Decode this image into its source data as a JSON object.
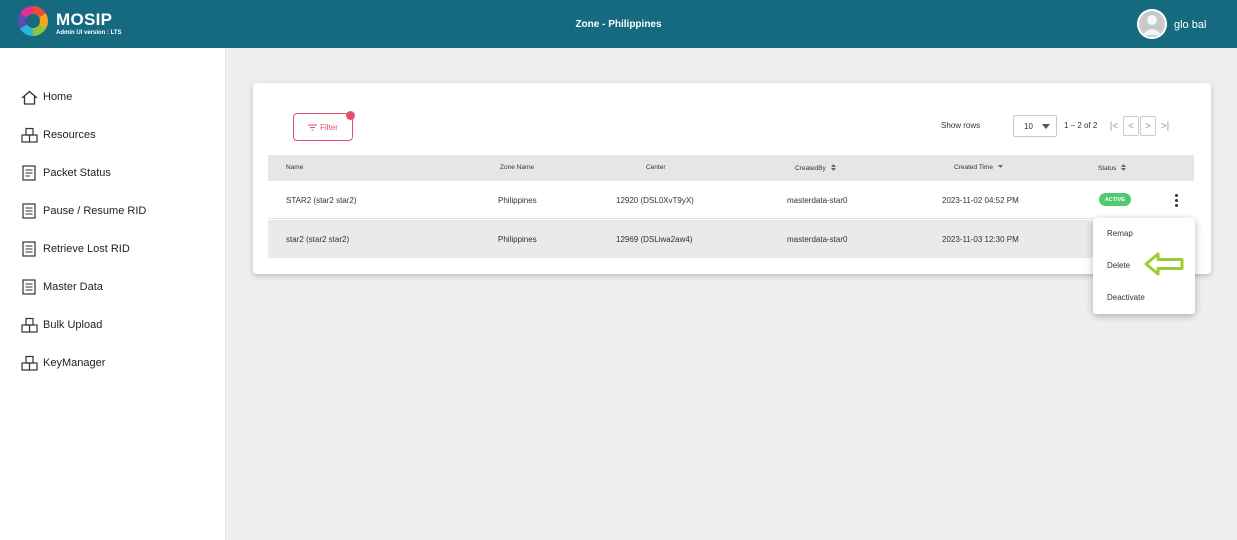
{
  "header": {
    "brand": "MOSIP",
    "version": "Admin UI version : LTS",
    "zone": "Zone - Philippines",
    "user_name": "glo bal"
  },
  "sidebar": {
    "items": [
      {
        "label": "Home",
        "icon": "home-icon"
      },
      {
        "label": "Resources",
        "icon": "resources-icon"
      },
      {
        "label": "Packet Status",
        "icon": "packet-status-icon"
      },
      {
        "label": "Pause / Resume RID",
        "icon": "document-icon"
      },
      {
        "label": "Retrieve Lost RID",
        "icon": "document-icon"
      },
      {
        "label": "Master Data",
        "icon": "document-icon"
      },
      {
        "label": "Bulk Upload",
        "icon": "upload-icon"
      },
      {
        "label": "KeyManager",
        "icon": "key-manager-icon"
      }
    ]
  },
  "toolbar": {
    "filter_label": "Filter",
    "show_rows_label": "Show rows",
    "rows_value": "10",
    "range_label": "1 – 2 of 2"
  },
  "table": {
    "columns": [
      "Name",
      "Zone Name",
      "Center",
      "CreatedBy",
      "Created Time",
      "Status"
    ],
    "rows": [
      {
        "name": "STAR2 (star2 star2)",
        "zone": "Philippines",
        "center": "12920 (DSL0XvT9yX)",
        "created_by": "masterdata-star0",
        "created_time": "2023-11-02 04:52 PM",
        "status": "ACTIVE"
      },
      {
        "name": "star2 (star2 star2)",
        "zone": "Philippines",
        "center": "12969 (DSLiwa2aw4)",
        "created_by": "masterdata-star0",
        "created_time": "2023-11-03 12:30 PM",
        "status": ""
      }
    ]
  },
  "menu": {
    "items": [
      "Remap",
      "Delete",
      "Deactivate"
    ]
  },
  "colors": {
    "header": "#166a80",
    "accent": "#e2526f",
    "active": "#4ecb71",
    "annotation_arrow": "#9acd32"
  }
}
